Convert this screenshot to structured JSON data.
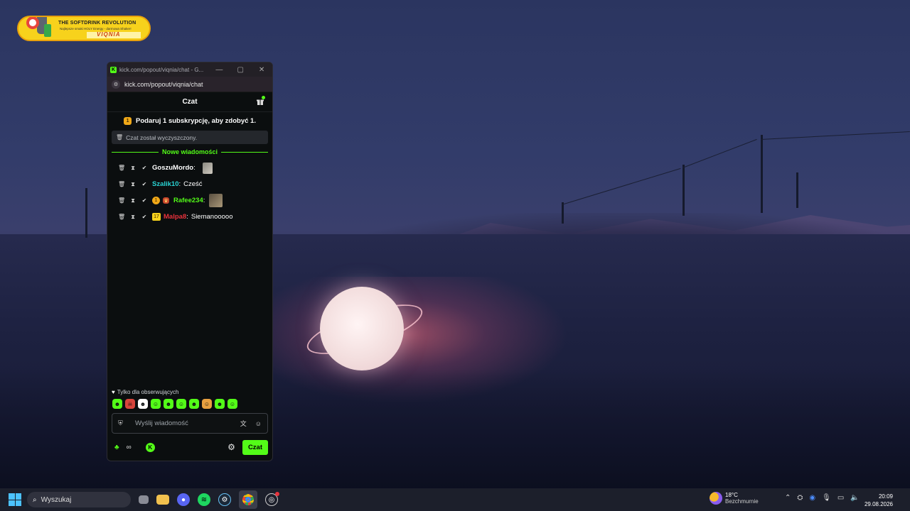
{
  "logo": {
    "line1": "THE SOFTDRINK REVOLUTION",
    "line2": "Najlepsze smaki HOLY Energy - darmowa Shaker!",
    "line3": "VIQNIA"
  },
  "browser": {
    "window_title": "kick.com/popout/viqnia/chat - G...",
    "url": "kick.com/popout/viqnia/chat"
  },
  "chat": {
    "header_title": "Czat",
    "promo_text": "Podaruj 1 subskrypcję, aby zdobyć 1.",
    "promo_badge": "1",
    "cleared_text": "Czat został wyczyszczony.",
    "divider_label": "Nowe wiadomości",
    "messages": [
      {
        "user": "GoszuMordo",
        "user_color": "#ffffff",
        "text": "",
        "emote": true
      },
      {
        "user": "Szalik10",
        "user_color": "#2ad4d4",
        "text": "Cześć",
        "emote": false
      },
      {
        "user": "Rafee234",
        "user_color": "#53fc18",
        "text": "",
        "emote": true,
        "sub_badge": "1"
      },
      {
        "user": "Malpa8",
        "user_color": "#e8323c",
        "text": "Siemanooooo",
        "emote": false,
        "sub_badge": "17"
      }
    ],
    "followers_only": "Tylko dla obserwujących",
    "input_placeholder": "Wyślij wiadomość",
    "send_label": "Czat"
  },
  "taskbar": {
    "search_placeholder": "Wyszukaj",
    "weather_temp": "18°C",
    "weather_desc": "Bezchmurnie",
    "time": "20:09",
    "date": "29.08.2026"
  },
  "colors": {
    "accent": "#53fc18",
    "chat_bg": "#0b0e0f"
  }
}
